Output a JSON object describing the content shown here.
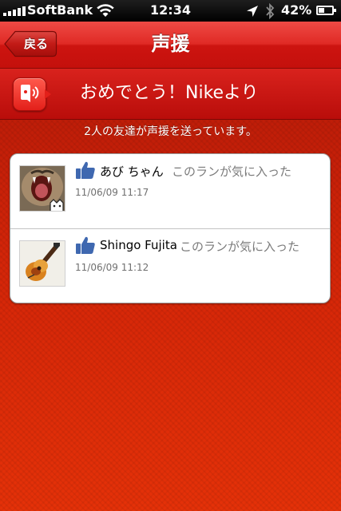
{
  "status_bar": {
    "carrier": "SoftBank",
    "time": "12:34",
    "battery": "42%",
    "battery_level": 0.42,
    "icons": [
      "signal-bars-icon",
      "wifi-icon",
      "location-arrow-icon",
      "bluetooth-icon",
      "battery-icon"
    ]
  },
  "navbar": {
    "back_label": "戻る",
    "title": "声援"
  },
  "banner": {
    "icon": "speaker-bubble-icon",
    "message": "おめでとう！Nikeより"
  },
  "summary": "2人の友達が声援を送っています。",
  "cheers": [
    {
      "name": "あび ちゃん",
      "action": "このランが気に入った",
      "timestamp": "11/06/09 11:17",
      "avatar": "cat-photo",
      "icon": "thumbs-up-icon"
    },
    {
      "name": "Shingo Fujita",
      "action": "このランが気に入った",
      "timestamp": "11/06/09 11:12",
      "avatar": "guitar-photo",
      "icon": "thumbs-up-icon"
    }
  ],
  "colors": {
    "nav_red": "#e02a25",
    "background_red": "#e12808",
    "like_blue": "#3f68b0"
  }
}
